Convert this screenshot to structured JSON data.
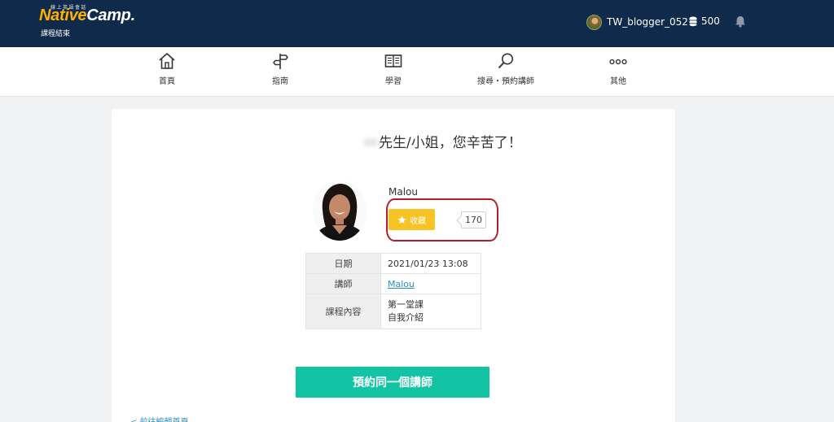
{
  "header": {
    "logo_tagline": "線上英語會話",
    "logo_native": "Native",
    "logo_camp": "Camp",
    "logo_dot": ".",
    "subtitle": "課程結束",
    "username": "TW_blogger_052",
    "coins": "500",
    "colors": {
      "bar": "#0f2a4a",
      "logo_accent": "#ffb000"
    }
  },
  "nav": {
    "items": [
      {
        "label": "首頁",
        "icon": "home-icon"
      },
      {
        "label": "指南",
        "icon": "signpost-icon"
      },
      {
        "label": "學習",
        "icon": "book-icon"
      },
      {
        "label": "搜尋・預約講師",
        "icon": "search-icon"
      },
      {
        "label": "其他",
        "icon": "more-icon"
      }
    ]
  },
  "main": {
    "greeting": "先生/小姐，您辛苦了！",
    "teacher_name": "Malou",
    "favorite_label": "收藏",
    "favorite_count": "170",
    "details": {
      "date_label": "日期",
      "date_value": "2021/01/23 13:08",
      "teacher_label": "講師",
      "teacher_value": "Malou",
      "content_label": "課程內容",
      "content_line1": "第一堂課",
      "content_line2": "自我介紹"
    },
    "book_button": "預約同一個講師",
    "back_link": "< 前往編輯首頁",
    "colors": {
      "favorite": "#f7c325",
      "book": "#12c3a4",
      "highlight": "#b51d2a"
    }
  }
}
